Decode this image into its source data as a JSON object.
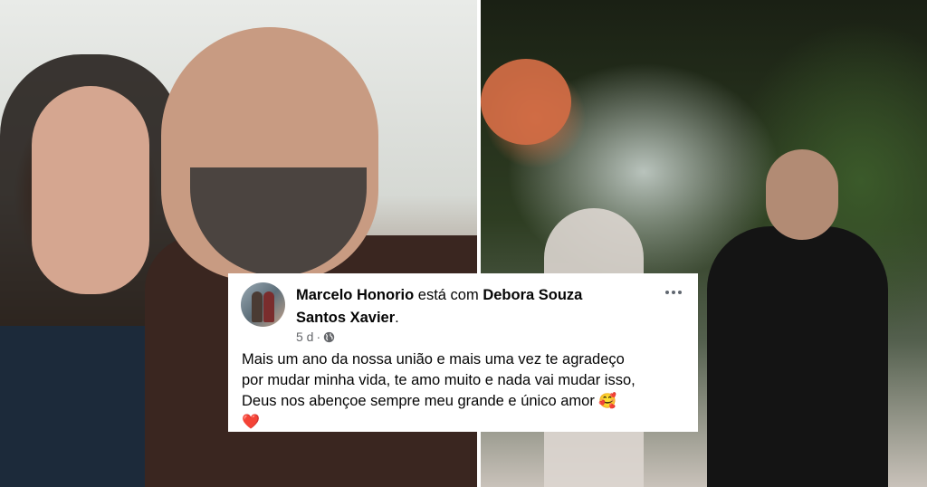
{
  "post": {
    "author": "Marcelo Honorio",
    "with_word": "está com",
    "tagged_part1": "Debora Souza",
    "tagged_part2": "Santos Xavier",
    "period": ".",
    "time": "5 d",
    "separator": "·",
    "more_icon": "ellipsis-icon",
    "privacy_icon": "globe-icon",
    "text_line1": "Mais um ano da nossa união e mais uma vez te agradeço",
    "text_line2": "por mudar minha vida, te amo muito e nada vai mudar isso,",
    "text_line3": "Deus nos abençoe sempre meu grande e único amor",
    "emoji_smiling_hearts": "🥰",
    "emoji_heart": "❤️"
  },
  "colors": {
    "text_primary": "#050505",
    "text_secondary": "#65676b",
    "card_bg": "#ffffff"
  }
}
